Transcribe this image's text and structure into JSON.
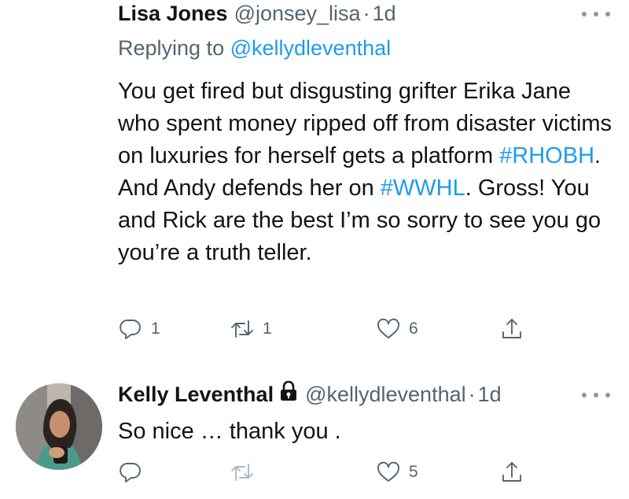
{
  "tweets": [
    {
      "author_name": "Lisa Jones",
      "author_handle": "@jonsey_lisa",
      "separator": "·",
      "time": "1d",
      "replying_label": "Replying to",
      "replying_to": "@kellydleventhal",
      "text_parts": [
        "You get fired but disgusting grifter Erika Jane who spent money ripped off from disaster victims on luxuries for herself gets a platform ",
        "#RHOBH",
        ". And Andy defends her on ",
        "#WWHL",
        ". Gross! You and Rick are the best I’m so sorry to see you go you’re a truth teller."
      ],
      "reply_count": "1",
      "retweet_count": "1",
      "like_count": "6"
    },
    {
      "author_name": "Kelly Leventhal",
      "locked": true,
      "author_handle": "@kellydleventhal",
      "separator": "·",
      "time": "1d",
      "text": "So nice … thank you .",
      "reply_count": "",
      "retweet_count": "",
      "like_count": "5"
    }
  ],
  "icons": {
    "reply": "reply-icon",
    "retweet": "retweet-icon",
    "like": "heart-icon",
    "share": "share-icon",
    "more": "more-icon",
    "lock": "lock-icon"
  },
  "colors": {
    "link": "#1d9bf0",
    "secondary_text": "#536471",
    "primary_text": "#0f1419"
  }
}
